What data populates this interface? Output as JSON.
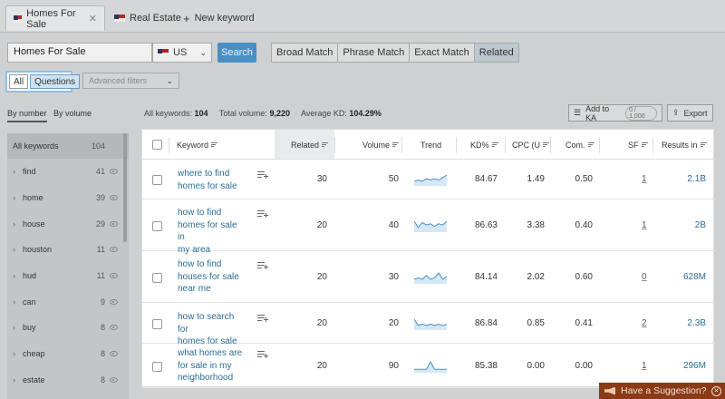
{
  "tabs": [
    {
      "label": "Homes For Sale",
      "close": "✕"
    },
    {
      "label": "Real Estate"
    },
    {
      "label": "New keyword",
      "icon": "plus-icon"
    }
  ],
  "search": {
    "value": "Homes For Sale",
    "database": "US",
    "button": "Search"
  },
  "match_types": [
    "Broad Match",
    "Phrase Match",
    "Exact Match",
    "Related"
  ],
  "question_toggle": {
    "all": "All",
    "questions": "Questions"
  },
  "advanced_filters": "Advanced filters",
  "sort": {
    "by_number": "By number",
    "by_volume": "By volume"
  },
  "stats": {
    "all_keywords_label": "All keywords:",
    "all_keywords": "104",
    "total_volume_label": "Total volume:",
    "total_volume": "9,220",
    "avg_kd_label": "Average KD:",
    "avg_kd": "104.29%"
  },
  "actions": {
    "add_to_ka": "Add to KA",
    "ka_count": "0 / 1,000",
    "export": "Export"
  },
  "sidebar": {
    "header": {
      "label": "All keywords",
      "count": "104"
    },
    "items": [
      {
        "label": "find",
        "count": "41"
      },
      {
        "label": "home",
        "count": "39"
      },
      {
        "label": "house",
        "count": "29"
      },
      {
        "label": "houston",
        "count": "11"
      },
      {
        "label": "hud",
        "count": "11"
      },
      {
        "label": "can",
        "count": "9"
      },
      {
        "label": "buy",
        "count": "8"
      },
      {
        "label": "cheap",
        "count": "8"
      },
      {
        "label": "estate",
        "count": "8"
      }
    ]
  },
  "table": {
    "columns": [
      "Keyword",
      "Related",
      "Volume",
      "Trend",
      "KD%",
      "CPC (U",
      "Com.",
      "SF",
      "Results in"
    ],
    "rows": [
      {
        "keyword": [
          "where to find",
          "homes for sale"
        ],
        "related": "30",
        "volume": "50",
        "kd": "84.67",
        "cpc": "1.49",
        "com": "0.50",
        "sf": "1",
        "results": "2.1B",
        "trend": [
          3,
          4,
          3,
          5,
          4,
          5,
          4,
          6,
          8
        ]
      },
      {
        "keyword": [
          "how to find",
          "homes for sale in",
          "my area"
        ],
        "related": "20",
        "volume": "40",
        "kd": "86.63",
        "cpc": "3.38",
        "com": "0.40",
        "sf": "1",
        "results": "2B",
        "trend": [
          8,
          3,
          7,
          5,
          6,
          4,
          6,
          5,
          8
        ]
      },
      {
        "keyword": [
          "how to find",
          "houses for sale",
          "near me"
        ],
        "related": "20",
        "volume": "30",
        "kd": "84.14",
        "cpc": "2.02",
        "com": "0.60",
        "sf": "0",
        "results": "628M",
        "trend": [
          3,
          4,
          3,
          6,
          3,
          4,
          8,
          3,
          5
        ]
      },
      {
        "keyword": [
          "how to search for",
          "homes for sale"
        ],
        "related": "20",
        "volume": "20",
        "kd": "86.84",
        "cpc": "0.85",
        "com": "0.41",
        "sf": "2",
        "results": "2.3B",
        "trend": [
          8,
          3,
          4,
          3,
          4,
          3,
          4,
          3,
          4
        ]
      },
      {
        "keyword": [
          "what homes are",
          "for sale in my",
          "neighborhood"
        ],
        "related": "20",
        "volume": "90",
        "kd": "85.38",
        "cpc": "0.00",
        "com": "0.00",
        "sf": "1",
        "results": "296M",
        "trend": [
          2,
          2,
          2,
          2,
          8,
          2,
          2,
          2,
          2
        ]
      }
    ]
  },
  "suggestion": "Have a Suggestion?",
  "colors": {
    "accent": "#4a8fc4",
    "link": "#2c6e96",
    "suggestion_bg": "#8a3a15"
  }
}
